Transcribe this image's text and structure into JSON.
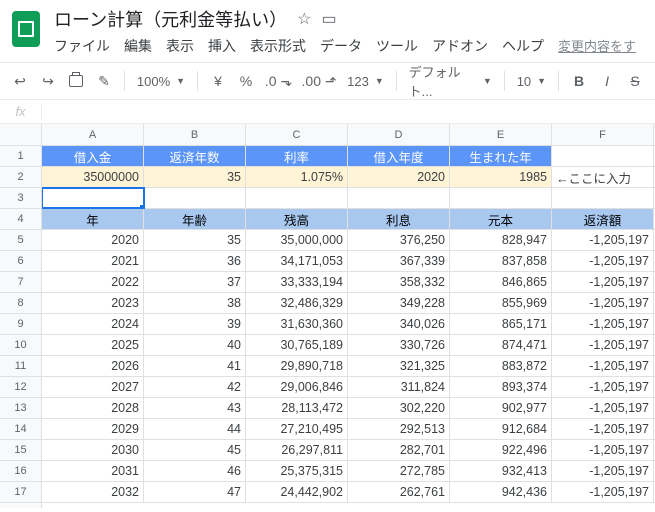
{
  "doc": {
    "title": "ローン計算（元利金等払い）"
  },
  "menu": {
    "file": "ファイル",
    "edit": "編集",
    "view": "表示",
    "insert": "挿入",
    "format": "表示形式",
    "data": "データ",
    "tools": "ツール",
    "addons": "アドオン",
    "help": "ヘルプ",
    "change": "変更内容をす"
  },
  "toolbar": {
    "zoom": "100%",
    "currency": "¥",
    "percent": "%",
    "more_formats": "123",
    "font": "デフォルト...",
    "font_size": "10"
  },
  "fx": {
    "label": "fx"
  },
  "columns": [
    "A",
    "B",
    "C",
    "D",
    "E",
    "F"
  ],
  "rows": [
    "1",
    "2",
    "3",
    "4",
    "5",
    "6",
    "7",
    "8",
    "9",
    "10",
    "11",
    "12",
    "13",
    "14",
    "15",
    "16",
    "17"
  ],
  "header1": {
    "A": "借入金",
    "B": "返済年数",
    "C": "利率",
    "D": "借入年度",
    "E": "生まれた年",
    "F": ""
  },
  "inputs": {
    "A": "35000000",
    "B": "35",
    "C": "1.075%",
    "D": "2020",
    "E": "1985",
    "F": "←ここに入力"
  },
  "header2": {
    "A": "年",
    "B": "年齢",
    "C": "残高",
    "D": "利息",
    "E": "元本",
    "F": "返済額"
  },
  "table": [
    {
      "A": "2020",
      "B": "35",
      "C": "35,000,000",
      "D": "376,250",
      "E": "828,947",
      "F": "-1,205,197"
    },
    {
      "A": "2021",
      "B": "36",
      "C": "34,171,053",
      "D": "367,339",
      "E": "837,858",
      "F": "-1,205,197"
    },
    {
      "A": "2022",
      "B": "37",
      "C": "33,333,194",
      "D": "358,332",
      "E": "846,865",
      "F": "-1,205,197"
    },
    {
      "A": "2023",
      "B": "38",
      "C": "32,486,329",
      "D": "349,228",
      "E": "855,969",
      "F": "-1,205,197"
    },
    {
      "A": "2024",
      "B": "39",
      "C": "31,630,360",
      "D": "340,026",
      "E": "865,171",
      "F": "-1,205,197"
    },
    {
      "A": "2025",
      "B": "40",
      "C": "30,765,189",
      "D": "330,726",
      "E": "874,471",
      "F": "-1,205,197"
    },
    {
      "A": "2026",
      "B": "41",
      "C": "29,890,718",
      "D": "321,325",
      "E": "883,872",
      "F": "-1,205,197"
    },
    {
      "A": "2027",
      "B": "42",
      "C": "29,006,846",
      "D": "311,824",
      "E": "893,374",
      "F": "-1,205,197"
    },
    {
      "A": "2028",
      "B": "43",
      "C": "28,113,472",
      "D": "302,220",
      "E": "902,977",
      "F": "-1,205,197"
    },
    {
      "A": "2029",
      "B": "44",
      "C": "27,210,495",
      "D": "292,513",
      "E": "912,684",
      "F": "-1,205,197"
    },
    {
      "A": "2030",
      "B": "45",
      "C": "26,297,811",
      "D": "282,701",
      "E": "922,496",
      "F": "-1,205,197"
    },
    {
      "A": "2031",
      "B": "46",
      "C": "25,375,315",
      "D": "272,785",
      "E": "932,413",
      "F": "-1,205,197"
    },
    {
      "A": "2032",
      "B": "47",
      "C": "24,442,902",
      "D": "262,761",
      "E": "942,436",
      "F": "-1,205,197"
    }
  ]
}
